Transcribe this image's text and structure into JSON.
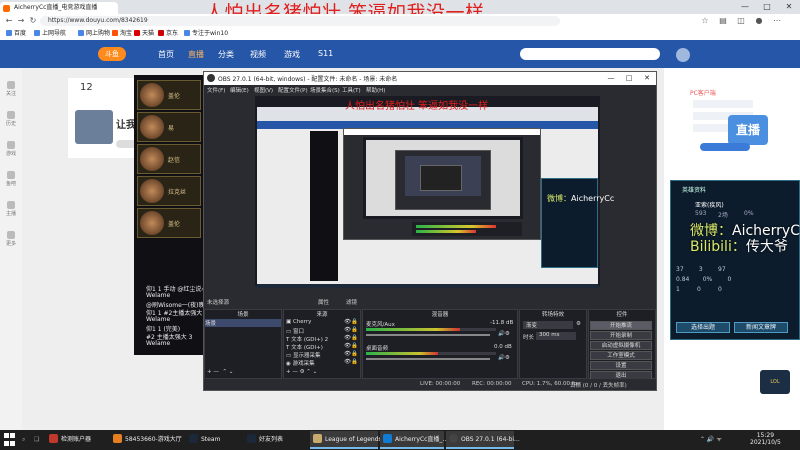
{
  "overlay": {
    "top_caption": "人怕出名猪怕壮 笨逼如我没一样",
    "preview_caption": "人怕出名猪怕壮 笨逼如我没一样"
  },
  "browser": {
    "tab_title": "AicherryCc直播_电竞游戏直播",
    "url": "https://www.douyu.com/8342619",
    "bookmarks": [
      "百度",
      "上网导航",
      "网上购物",
      "淘宝",
      "天猫",
      "京东",
      "专注于win10"
    ],
    "window_controls": [
      "—",
      "□",
      "✕"
    ]
  },
  "douyu": {
    "nav_links": [
      "首页",
      "直播",
      "分类",
      "视频",
      "游戏",
      "S11"
    ],
    "room_number": "12",
    "room_title": "让我",
    "sidebar": [
      "关注",
      "历史",
      "游戏",
      "鱼吧",
      "主播",
      "更多"
    ],
    "chat_lines": [
      "仰1 1 手动 @红尘说心情",
      "Welame",
      "@刷Wisome一(夜)晚",
      "仰1 1 #2主播太强大",
      "Welame",
      "仰1 1 (完美)",
      "#2 主播太强大 3",
      "Welame"
    ],
    "hero_names": [
      "盖伦",
      "易",
      "赵信",
      "拉克丝"
    ],
    "rank_title": "PC客户端",
    "rank_badge": "直播"
  },
  "stats": {
    "title": "英雄资料",
    "name": "亚索(疾风)",
    "values": [
      "593",
      "2场",
      "0%"
    ],
    "rows": [
      [
        "37",
        "3",
        "97"
      ],
      [
        "0.84",
        "0%",
        "0"
      ],
      [
        "1",
        "0",
        "0"
      ]
    ],
    "caption_line1_prefix": "微博：",
    "caption_line1_name": "AicherryCc",
    "caption_line2_prefix": "Bilibili：",
    "caption_line2_name": "传大爷",
    "btn_exit": "选择出题",
    "btn_recruit": "新闻文章牌"
  },
  "obs": {
    "title": "OBS 27.0.1 (64-bit, windows) - 配置文件: 未命名 - 场景: 未命名",
    "menus": [
      "文件(F)",
      "编辑(E)",
      "视图(V)",
      "配置文件(P)",
      "场景集合(S)",
      "工具(T)",
      "帮助(H)"
    ],
    "no_source": "未选择源",
    "properties": "属性",
    "filters": "滤镜",
    "docks": {
      "scenes": "场景",
      "sources": "来源",
      "mixer": "混音器",
      "transitions": "转场特效",
      "controls": "控件"
    },
    "scene_items": [
      "场景"
    ],
    "source_items": [
      "Cherry",
      "窗口",
      "文本 (GDI+) 2",
      "文本 (GDI+)",
      "显示器采集",
      "游戏采集"
    ],
    "mixer": [
      {
        "name": "麦克风/Aux",
        "db": "-11.8 dB"
      },
      {
        "name": "桌面音频",
        "db": "0.0 dB"
      }
    ],
    "mixer_levels": [
      0.72,
      0.55
    ],
    "transition": "渐变",
    "duration_label": "时长",
    "duration": "300 ms",
    "controls": [
      "开始推流",
      "开始录制",
      "启动虚拟摄像机",
      "工作室模式",
      "设置",
      "退出"
    ],
    "status": {
      "live": "LIVE: 00:00:00",
      "rec": "REC: 00:00:00",
      "cpu": "CPU: 1.7%, 60.00 fps",
      "dropped": "丢帧 (0 / 0 / 丢失帧率)"
    }
  },
  "taskbar": {
    "items": [
      "检测账户器",
      "58453660-游戏大厅",
      "Steam",
      "好友列表",
      "League of Legends",
      "AicherryCc直播_...",
      "OBS 27.0.1 (64-bi..."
    ],
    "time": "15:29",
    "date": "2021/10/5"
  },
  "colors": {
    "overlay_red": "#e0201e",
    "douyu_blue": "#2556a7",
    "obs_dark": "#2a2b30",
    "taskbar": "#1f1f1f"
  }
}
